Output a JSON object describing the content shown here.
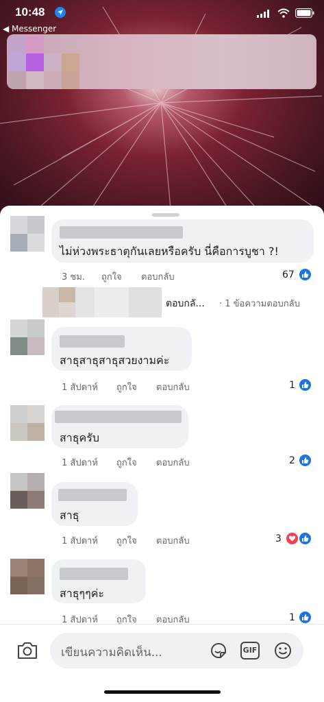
{
  "status_bar": {
    "time": "10:48",
    "back_app": "◀ Messenger"
  },
  "comments": [
    {
      "text": "ไม่ห่วงพระธาตุกันเลยหรือครับ นี่คือการบูชา ?!",
      "time": "3 ชม.",
      "like": "ถูกใจ",
      "reply": "ตอบกลับ",
      "reactions": "67",
      "reaction_type": "like"
    },
    {
      "text": "สาธุสาธุสาธุสวยงามค่ะ",
      "time": "1 สัปดาห์",
      "like": "ถูกใจ",
      "reply": "ตอบกลับ",
      "reactions": "1",
      "reaction_type": "like"
    },
    {
      "text": "สาธุครับ",
      "time": "1 สัปดาห์",
      "like": "ถูกใจ",
      "reply": "ตอบกลับ",
      "reactions": "2",
      "reaction_type": "like"
    },
    {
      "text": "สาธุ",
      "time": "1 สัปดาห์",
      "like": "ถูกใจ",
      "reply": "ตอบกลับ",
      "reactions": "3",
      "reaction_type": "heart+like"
    },
    {
      "text": "สาธุๆๆค่ะ",
      "time": "1 สัปดาห์",
      "like": "ถูกใจ",
      "reply": "ตอบกลับ",
      "reactions": "1",
      "reaction_type": "like"
    }
  ],
  "reply_summary": {
    "label": "ตอบกลั...",
    "count": "· 1 ข้อความตอบกลับ"
  },
  "composer": {
    "placeholder": "เขียนความคิดเห็น...",
    "gif_label": "GIF"
  },
  "colors": {
    "like_blue": "#1b74e4",
    "heart_red": "#f33e58",
    "bubble_bg": "#eff1f4",
    "meta_gray": "#65676b"
  },
  "icons": [
    "location-arrow-icon",
    "signal-icon",
    "wifi-icon",
    "battery-icon",
    "like-icon",
    "heart-icon",
    "camera-icon",
    "sticker-icon",
    "gif-icon",
    "emoji-icon"
  ]
}
